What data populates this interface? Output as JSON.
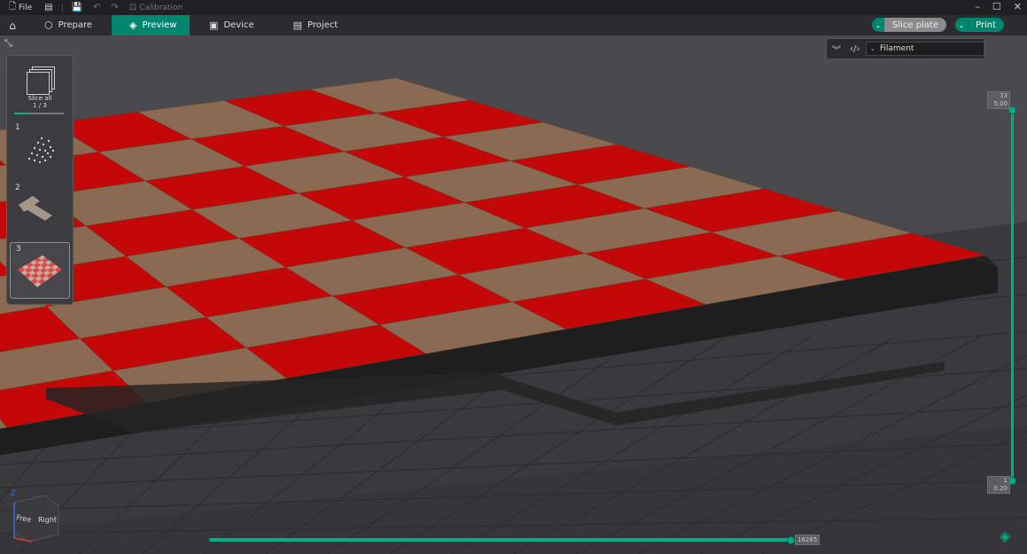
{
  "titlebar": {
    "file_label": "File",
    "calibration_label": "Calibration",
    "icons": [
      "file-icon",
      "menu-icon",
      "save-icon",
      "undo-icon",
      "redo-icon",
      "calibration-icon"
    ],
    "window_controls": [
      "minimize-icon",
      "maximize-icon",
      "close-icon"
    ]
  },
  "tabs": [
    {
      "label": "Prepare",
      "icon": "cube-icon"
    },
    {
      "label": "Preview",
      "icon": "layers-icon",
      "active": true
    },
    {
      "label": "Device",
      "icon": "device-icon"
    },
    {
      "label": "Project",
      "icon": "project-icon"
    }
  ],
  "actions": {
    "slice_plate": "Slice plate",
    "print": "Print"
  },
  "plates_panel": {
    "slice_all_label": "Slice all",
    "slice_progress": "1 / 3",
    "slice_fraction": 0.33,
    "plates": [
      {
        "number": "1"
      },
      {
        "number": "2"
      },
      {
        "number": "3",
        "selected": true
      }
    ]
  },
  "view_selector": {
    "value": "Filament"
  },
  "layer_slider": {
    "top_layer": "33",
    "top_height": "5.00",
    "bottom_layer": "1",
    "bottom_height": "0.20"
  },
  "move_slider": {
    "value": "16265"
  },
  "view_cube": {
    "face_left": "Free",
    "face_right": "Right",
    "axis_z": "Z"
  },
  "colors": {
    "accent": "#00ae8d",
    "tab_active": "#00856f",
    "filament_red": "#c40707",
    "filament_tan": "#8a6a52",
    "viewport_bg": "#4b4b4f"
  }
}
